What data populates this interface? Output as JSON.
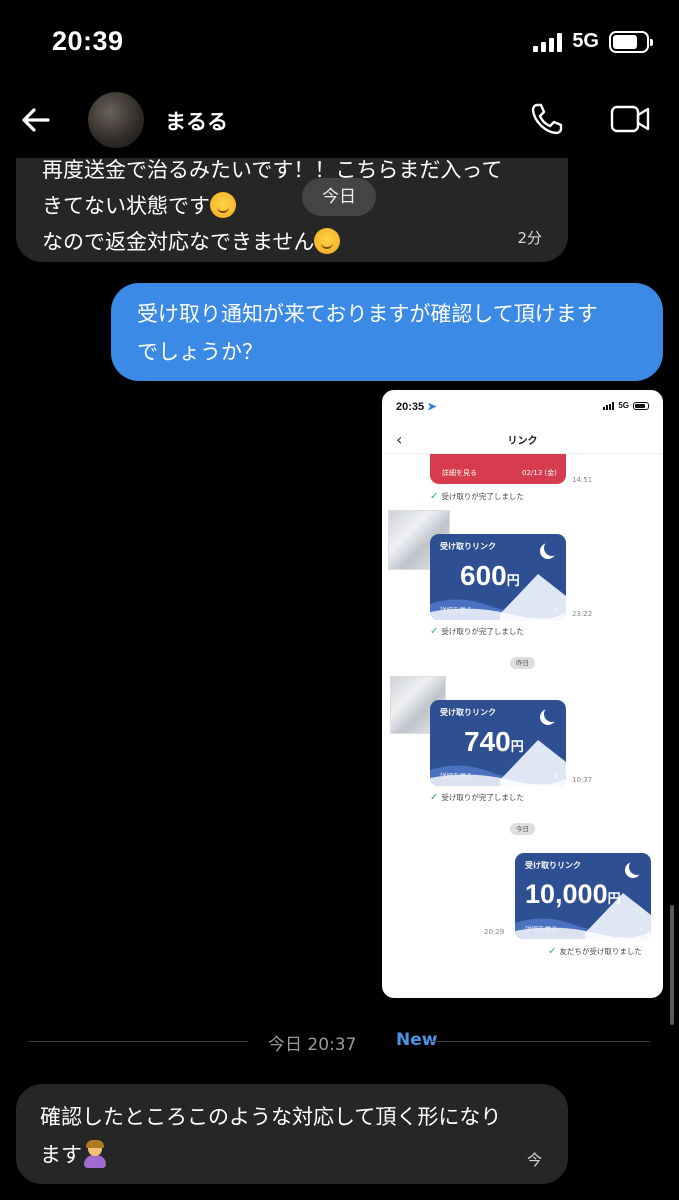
{
  "status_bar": {
    "time": "20:39",
    "network": "5G"
  },
  "header": {
    "contact_name": "まるる"
  },
  "messages": {
    "msg1": {
      "lines": [
        "再度送金で治るみたいです！！こちらまだ入って",
        "きてない状態です",
        "なので返金対応なできません"
      ],
      "time": "2分"
    },
    "date_pill": "今日",
    "msg2": {
      "lines": [
        "受け取り通知が来ておりますが確認して頂けます",
        "でしょうか？"
      ]
    },
    "screenshot": {
      "status_time": "20:35",
      "network": "5G",
      "nav_title": "リンク",
      "red_card": {
        "detail": "詳細を見る",
        "date": "02/13 (金)"
      },
      "red_time": "14:51",
      "received": "受け取りが完了しました",
      "card_title": "受け取りリンク",
      "card_detail": "詳細を見る",
      "cards": [
        {
          "amount": "600",
          "unit": "円",
          "time": "23:22"
        },
        {
          "amount": "740",
          "unit": "円",
          "time": "10:37"
        },
        {
          "amount": "10,000",
          "unit": "円",
          "time": "20:29"
        }
      ],
      "day_labels": [
        "昨日",
        "今日"
      ],
      "friend_received": "友だちが受け取りました"
    },
    "new_divider": {
      "label": "今日 20:37",
      "new": "New"
    },
    "msg3": {
      "lines": [
        "確認したところこのような対応して頂く形になり",
        "ます"
      ],
      "time": "今"
    }
  }
}
